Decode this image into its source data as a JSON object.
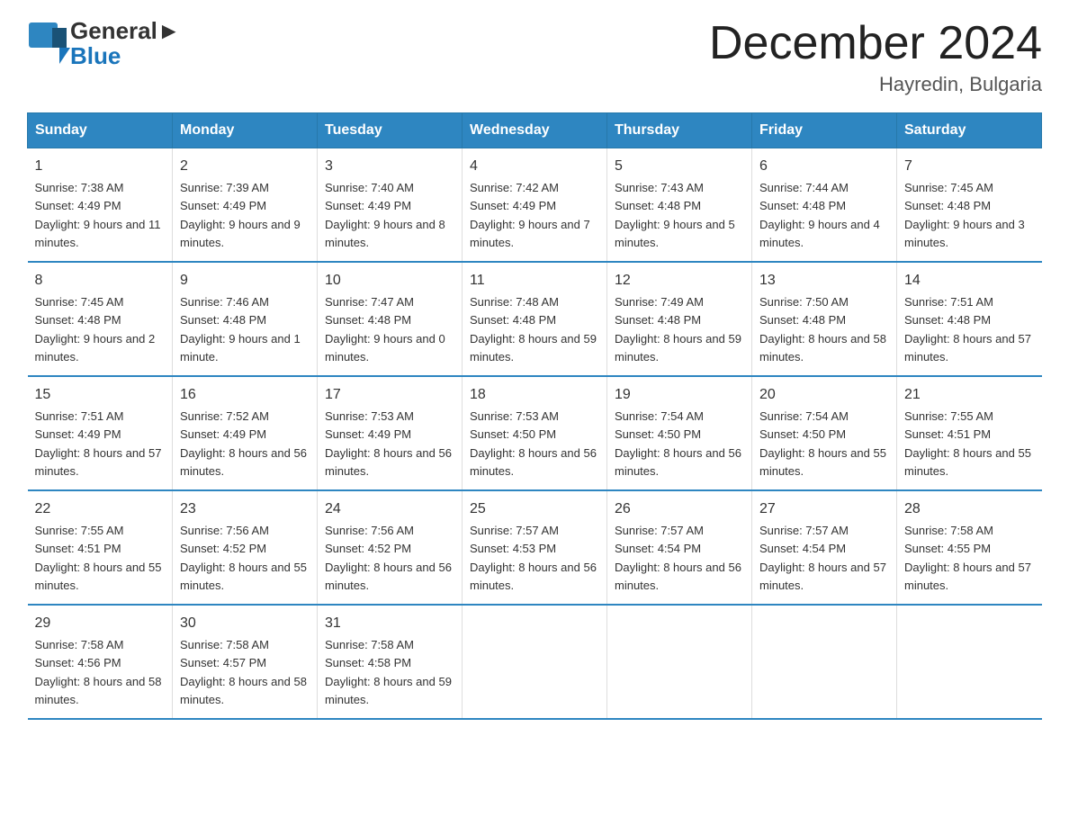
{
  "header": {
    "logo_general": "General",
    "logo_blue": "Blue",
    "month_title": "December 2024",
    "location": "Hayredin, Bulgaria"
  },
  "days_of_week": [
    "Sunday",
    "Monday",
    "Tuesday",
    "Wednesday",
    "Thursday",
    "Friday",
    "Saturday"
  ],
  "weeks": [
    [
      {
        "day": "1",
        "sunrise": "Sunrise: 7:38 AM",
        "sunset": "Sunset: 4:49 PM",
        "daylight": "Daylight: 9 hours and 11 minutes."
      },
      {
        "day": "2",
        "sunrise": "Sunrise: 7:39 AM",
        "sunset": "Sunset: 4:49 PM",
        "daylight": "Daylight: 9 hours and 9 minutes."
      },
      {
        "day": "3",
        "sunrise": "Sunrise: 7:40 AM",
        "sunset": "Sunset: 4:49 PM",
        "daylight": "Daylight: 9 hours and 8 minutes."
      },
      {
        "day": "4",
        "sunrise": "Sunrise: 7:42 AM",
        "sunset": "Sunset: 4:49 PM",
        "daylight": "Daylight: 9 hours and 7 minutes."
      },
      {
        "day": "5",
        "sunrise": "Sunrise: 7:43 AM",
        "sunset": "Sunset: 4:48 PM",
        "daylight": "Daylight: 9 hours and 5 minutes."
      },
      {
        "day": "6",
        "sunrise": "Sunrise: 7:44 AM",
        "sunset": "Sunset: 4:48 PM",
        "daylight": "Daylight: 9 hours and 4 minutes."
      },
      {
        "day": "7",
        "sunrise": "Sunrise: 7:45 AM",
        "sunset": "Sunset: 4:48 PM",
        "daylight": "Daylight: 9 hours and 3 minutes."
      }
    ],
    [
      {
        "day": "8",
        "sunrise": "Sunrise: 7:45 AM",
        "sunset": "Sunset: 4:48 PM",
        "daylight": "Daylight: 9 hours and 2 minutes."
      },
      {
        "day": "9",
        "sunrise": "Sunrise: 7:46 AM",
        "sunset": "Sunset: 4:48 PM",
        "daylight": "Daylight: 9 hours and 1 minute."
      },
      {
        "day": "10",
        "sunrise": "Sunrise: 7:47 AM",
        "sunset": "Sunset: 4:48 PM",
        "daylight": "Daylight: 9 hours and 0 minutes."
      },
      {
        "day": "11",
        "sunrise": "Sunrise: 7:48 AM",
        "sunset": "Sunset: 4:48 PM",
        "daylight": "Daylight: 8 hours and 59 minutes."
      },
      {
        "day": "12",
        "sunrise": "Sunrise: 7:49 AM",
        "sunset": "Sunset: 4:48 PM",
        "daylight": "Daylight: 8 hours and 59 minutes."
      },
      {
        "day": "13",
        "sunrise": "Sunrise: 7:50 AM",
        "sunset": "Sunset: 4:48 PM",
        "daylight": "Daylight: 8 hours and 58 minutes."
      },
      {
        "day": "14",
        "sunrise": "Sunrise: 7:51 AM",
        "sunset": "Sunset: 4:48 PM",
        "daylight": "Daylight: 8 hours and 57 minutes."
      }
    ],
    [
      {
        "day": "15",
        "sunrise": "Sunrise: 7:51 AM",
        "sunset": "Sunset: 4:49 PM",
        "daylight": "Daylight: 8 hours and 57 minutes."
      },
      {
        "day": "16",
        "sunrise": "Sunrise: 7:52 AM",
        "sunset": "Sunset: 4:49 PM",
        "daylight": "Daylight: 8 hours and 56 minutes."
      },
      {
        "day": "17",
        "sunrise": "Sunrise: 7:53 AM",
        "sunset": "Sunset: 4:49 PM",
        "daylight": "Daylight: 8 hours and 56 minutes."
      },
      {
        "day": "18",
        "sunrise": "Sunrise: 7:53 AM",
        "sunset": "Sunset: 4:50 PM",
        "daylight": "Daylight: 8 hours and 56 minutes."
      },
      {
        "day": "19",
        "sunrise": "Sunrise: 7:54 AM",
        "sunset": "Sunset: 4:50 PM",
        "daylight": "Daylight: 8 hours and 56 minutes."
      },
      {
        "day": "20",
        "sunrise": "Sunrise: 7:54 AM",
        "sunset": "Sunset: 4:50 PM",
        "daylight": "Daylight: 8 hours and 55 minutes."
      },
      {
        "day": "21",
        "sunrise": "Sunrise: 7:55 AM",
        "sunset": "Sunset: 4:51 PM",
        "daylight": "Daylight: 8 hours and 55 minutes."
      }
    ],
    [
      {
        "day": "22",
        "sunrise": "Sunrise: 7:55 AM",
        "sunset": "Sunset: 4:51 PM",
        "daylight": "Daylight: 8 hours and 55 minutes."
      },
      {
        "day": "23",
        "sunrise": "Sunrise: 7:56 AM",
        "sunset": "Sunset: 4:52 PM",
        "daylight": "Daylight: 8 hours and 55 minutes."
      },
      {
        "day": "24",
        "sunrise": "Sunrise: 7:56 AM",
        "sunset": "Sunset: 4:52 PM",
        "daylight": "Daylight: 8 hours and 56 minutes."
      },
      {
        "day": "25",
        "sunrise": "Sunrise: 7:57 AM",
        "sunset": "Sunset: 4:53 PM",
        "daylight": "Daylight: 8 hours and 56 minutes."
      },
      {
        "day": "26",
        "sunrise": "Sunrise: 7:57 AM",
        "sunset": "Sunset: 4:54 PM",
        "daylight": "Daylight: 8 hours and 56 minutes."
      },
      {
        "day": "27",
        "sunrise": "Sunrise: 7:57 AM",
        "sunset": "Sunset: 4:54 PM",
        "daylight": "Daylight: 8 hours and 57 minutes."
      },
      {
        "day": "28",
        "sunrise": "Sunrise: 7:58 AM",
        "sunset": "Sunset: 4:55 PM",
        "daylight": "Daylight: 8 hours and 57 minutes."
      }
    ],
    [
      {
        "day": "29",
        "sunrise": "Sunrise: 7:58 AM",
        "sunset": "Sunset: 4:56 PM",
        "daylight": "Daylight: 8 hours and 58 minutes."
      },
      {
        "day": "30",
        "sunrise": "Sunrise: 7:58 AM",
        "sunset": "Sunset: 4:57 PM",
        "daylight": "Daylight: 8 hours and 58 minutes."
      },
      {
        "day": "31",
        "sunrise": "Sunrise: 7:58 AM",
        "sunset": "Sunset: 4:58 PM",
        "daylight": "Daylight: 8 hours and 59 minutes."
      },
      {
        "day": "",
        "sunrise": "",
        "sunset": "",
        "daylight": ""
      },
      {
        "day": "",
        "sunrise": "",
        "sunset": "",
        "daylight": ""
      },
      {
        "day": "",
        "sunrise": "",
        "sunset": "",
        "daylight": ""
      },
      {
        "day": "",
        "sunrise": "",
        "sunset": "",
        "daylight": ""
      }
    ]
  ]
}
